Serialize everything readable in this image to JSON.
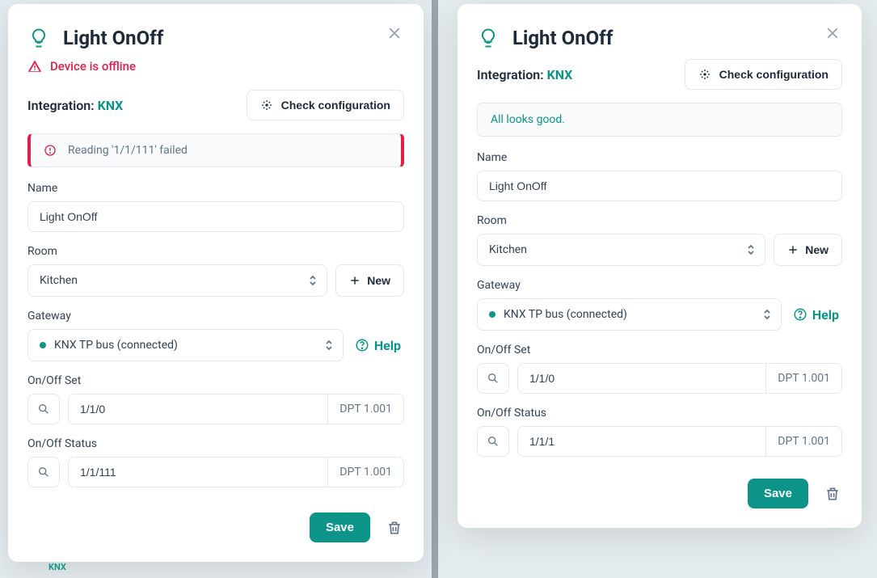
{
  "left": {
    "title": "Light OnOff",
    "offline_warning": "Device is offline",
    "integration_label": "Integration:",
    "integration_value": "KNX",
    "check_config": "Check configuration",
    "error_banner": "Reading '1/1/111' failed",
    "name_label": "Name",
    "name_value": "Light OnOff",
    "room_label": "Room",
    "room_value": "Kitchen",
    "new_button": "New",
    "gateway_label": "Gateway",
    "gateway_value": "KNX TP bus (connected)",
    "help_label": "Help",
    "onoff_set_label": "On/Off Set",
    "onoff_set_value": "1/1/0",
    "onoff_set_dpt": "DPT 1.001",
    "onoff_status_label": "On/Off Status",
    "onoff_status_value": "1/1/111",
    "onoff_status_dpt": "DPT 1.001",
    "save_label": "Save"
  },
  "right": {
    "title": "Light OnOff",
    "integration_label": "Integration:",
    "integration_value": "KNX",
    "check_config": "Check configuration",
    "success_banner": "All looks good.",
    "name_label": "Name",
    "name_value": "Light OnOff",
    "room_label": "Room",
    "room_value": "Kitchen",
    "new_button": "New",
    "gateway_label": "Gateway",
    "gateway_value": "KNX TP bus (connected)",
    "help_label": "Help",
    "onoff_set_label": "On/Off Set",
    "onoff_set_value": "1/1/0",
    "onoff_set_dpt": "DPT 1.001",
    "onoff_status_label": "On/Off Status",
    "onoff_status_value": "1/1/1",
    "onoff_status_dpt": "DPT 1.001",
    "save_label": "Save"
  },
  "bg": {
    "knx_tag": "KNX"
  }
}
